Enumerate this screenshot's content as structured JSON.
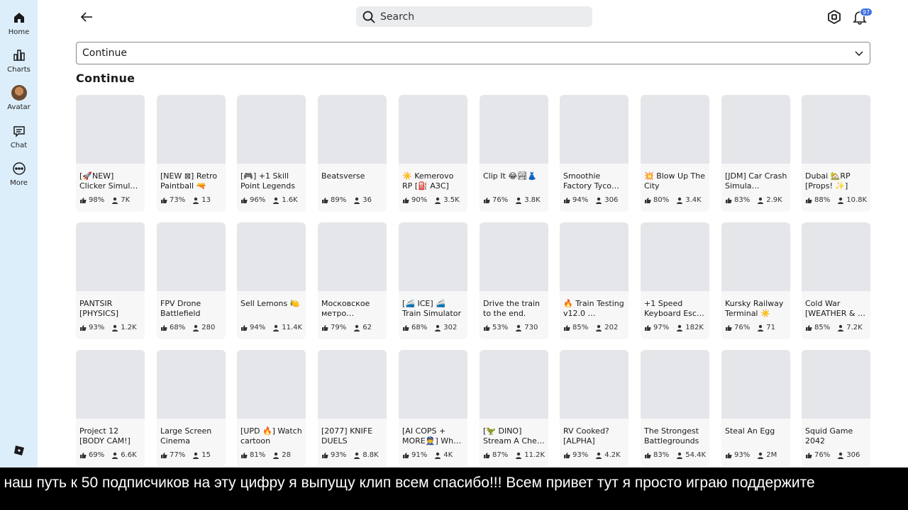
{
  "sidebar": {
    "items": [
      {
        "label": "Home",
        "icon": "home-icon"
      },
      {
        "label": "Charts",
        "icon": "charts-icon"
      },
      {
        "label": "Avatar",
        "icon": "avatar-icon"
      },
      {
        "label": "Chat",
        "icon": "chat-icon"
      },
      {
        "label": "More",
        "icon": "more-icon"
      }
    ]
  },
  "header": {
    "search_placeholder": "Search",
    "notification_count": "97"
  },
  "filter": {
    "selected": "Continue"
  },
  "section": {
    "title": "Continue"
  },
  "games": [
    {
      "title": "[🚀NEW] Clicker Simul…",
      "rating": "98%",
      "players": "7K"
    },
    {
      "title": "[NEW ⊠] Retro Paintball 🔫",
      "rating": "73%",
      "players": "13"
    },
    {
      "title": "[🎮] +1 Skill Point Legends",
      "rating": "96%",
      "players": "1.6K"
    },
    {
      "title": "Beatsverse",
      "rating": "89%",
      "players": "36"
    },
    {
      "title": "☀️ Kemerovo RP [⛽ АЗС]",
      "rating": "90%",
      "players": "3.5K"
    },
    {
      "title": "Clip It 😂🏞👗",
      "rating": "76%",
      "players": "3.8K"
    },
    {
      "title": "Smoothie Factory Tyco…",
      "rating": "94%",
      "players": "306"
    },
    {
      "title": "💥 Blow Up The City",
      "rating": "80%",
      "players": "3.4K"
    },
    {
      "title": "[JDM] Car Crash Simula…",
      "rating": "83%",
      "players": "2.9K"
    },
    {
      "title": "Dubai 🏡RP [Props! ✨]",
      "rating": "88%",
      "players": "10.8K"
    },
    {
      "title": "PANTSIR [PHYSICS]",
      "rating": "93%",
      "players": "1.2K"
    },
    {
      "title": "FPV Drone Battlefield",
      "rating": "68%",
      "players": "280"
    },
    {
      "title": "Sell Lemons 🍋",
      "rating": "94%",
      "players": "11.4K"
    },
    {
      "title": "Московское метро [Сокольн…",
      "rating": "79%",
      "players": "62"
    },
    {
      "title": "[🚄 ICE] 🚄 Train Simulator",
      "rating": "68%",
      "players": "302"
    },
    {
      "title": "Drive the train to the end.",
      "rating": "53%",
      "players": "730"
    },
    {
      "title": "🔥 Train Testing v12.0 …",
      "rating": "85%",
      "players": "202"
    },
    {
      "title": "+1 Speed Keyboard Esc…",
      "rating": "97%",
      "players": "182K"
    },
    {
      "title": "Kursky Railway Terminal ☀️",
      "rating": "76%",
      "players": "71"
    },
    {
      "title": "Cold War [WEATHER & …",
      "rating": "85%",
      "players": "7.2K"
    },
    {
      "title": "Project 12 [BODY CAM!]",
      "rating": "69%",
      "players": "6.6K"
    },
    {
      "title": "Large Screen Cinema",
      "rating": "77%",
      "players": "15"
    },
    {
      "title": "[UPD 🔥] Watch cartoon",
      "rating": "81%",
      "players": "28"
    },
    {
      "title": "[2077] KNIFE DUELS",
      "rating": "93%",
      "players": "8.8K"
    },
    {
      "title": "[AI COPS + MORE👮] Wh…",
      "rating": "91%",
      "players": "4K"
    },
    {
      "title": "[🦖 DINO] Stream A Che…",
      "rating": "87%",
      "players": "11.2K"
    },
    {
      "title": "RV Cooked? [ALPHA]",
      "rating": "93%",
      "players": "4.2K"
    },
    {
      "title": "The Strongest Battlegrounds",
      "rating": "83%",
      "players": "54.4K"
    },
    {
      "title": "Steal An Egg",
      "rating": "93%",
      "players": "2M"
    },
    {
      "title": "Squid Game 2042",
      "rating": "76%",
      "players": "306"
    }
  ],
  "subtitle": {
    "text": "е наш путь к 50 подписчиков на эту цифру я выпущу клип всем спасибо!!! Всем привет тут я просто играю поддержите"
  }
}
